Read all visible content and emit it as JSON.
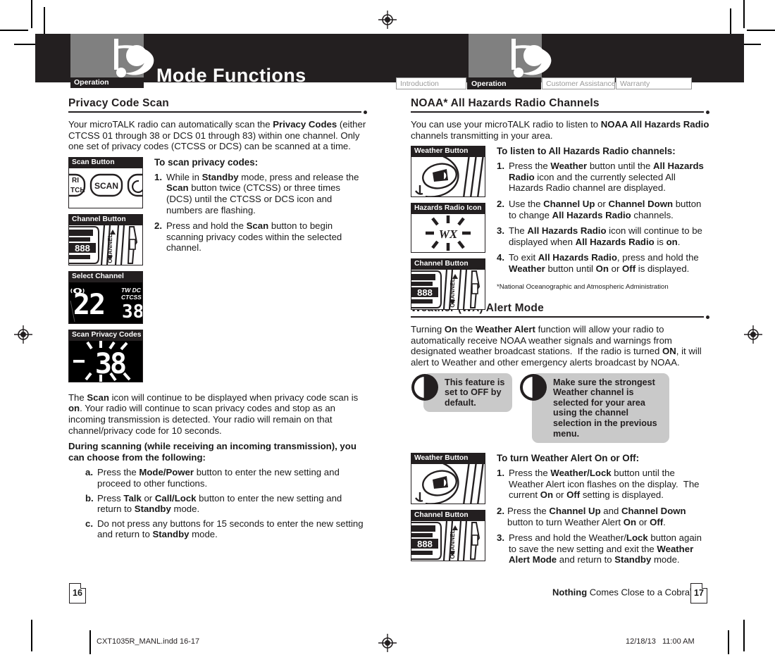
{
  "header": {
    "chapter_title": "Mode Functions",
    "section_tab_left": "Operation",
    "tabs": [
      {
        "label": "Introduction",
        "active": false
      },
      {
        "label": "Operation",
        "active": true
      },
      {
        "label": "Customer Assistance",
        "active": false
      },
      {
        "label": "Warranty",
        "active": false
      }
    ]
  },
  "left_column": {
    "section_title": "Privacy Code Scan",
    "intro": "Your microTALK radio can automatically scan the Privacy Codes (either CTCSS 01 through 38 or DCS 01 through 83) within one channel. Only one set of privacy codes (CTCSS or DCS) can be scanned at a time.",
    "figures": [
      {
        "caption": "Scan Button",
        "art": "scan-button",
        "lcd_text": "SCAN"
      },
      {
        "caption": "Channel Button",
        "art": "channel-button",
        "lcd_text": "888"
      },
      {
        "caption": "Select Channel",
        "art": "lcd-select-channel",
        "lcd_text": "22 38",
        "lcd_labels": "TW DC CTCSS"
      },
      {
        "caption": "Scan Privacy Codes",
        "art": "lcd-scan-privacy",
        "lcd_text": "38"
      }
    ],
    "sub_heading": "To scan privacy codes:",
    "steps": [
      {
        "num": "1.",
        "text": "While in Standby mode, press and release the Scan button twice (CTCSS) or three times (DCS) until the CTCSS or DCS icon and numbers are flashing."
      },
      {
        "num": "2.",
        "text": "Press and hold the Scan button to begin scanning privacy codes within the selected channel."
      }
    ],
    "body_after": "The Scan icon will continue to be displayed when privacy code scan is on. Your radio will continue to scan privacy codes and stop as an incoming transmission is detected. Your radio will remain on that channel/privacy code for 10 seconds.",
    "during_heading": "During scanning (while receiving an incoming transmission), you can choose from the following:",
    "alpha_steps": [
      {
        "num": "a.",
        "text": "Press the Mode/Power button to enter the new setting and proceed to other functions."
      },
      {
        "num": "b.",
        "text": "Press Talk or Call/Lock button to enter the new setting and return to Standby mode."
      },
      {
        "num": "c.",
        "text": "Do not press any buttons for 15 seconds to enter the new setting and return to Standby mode."
      }
    ]
  },
  "right_column": {
    "noaa": {
      "section_title": "NOAA* All Hazards Radio Channels",
      "intro": "You can use your microTALK radio to listen to NOAA All Hazards Radio channels transmitting in your area.",
      "figures": [
        {
          "caption": "Weather Button",
          "art": "weather-button"
        },
        {
          "caption": "Hazards Radio Icon",
          "art": "wx-icon",
          "lcd_text": "WX"
        },
        {
          "caption": "Channel Button",
          "art": "channel-button",
          "lcd_text": "888"
        }
      ],
      "sub_heading": "To listen to All Hazards Radio channels:",
      "steps": [
        {
          "num": "1.",
          "text": "Press the Weather button until the All Hazards Radio icon and the currently selected All Hazards Radio channel are displayed."
        },
        {
          "num": "2.",
          "text": "Use the Channel Up or Channel Down button to change All Hazards Radio channels."
        },
        {
          "num": "3.",
          "text": "The All Hazards Radio icon will continue to be displayed when All Hazards Radio is on."
        },
        {
          "num": "4.",
          "text": "To exit All Hazards Radio, press and hold the Weather button until On or Off is displayed."
        }
      ],
      "footnote": "*National Oceanographic and Atmospheric Administration"
    },
    "wx_alert": {
      "section_title": "Weather (WX) Alert Mode",
      "intro": "Turning On the Weather Alert function will allow your radio to automatically receive NOAA weather signals and warnings from designated weather broadcast stations.  If the radio is turned ON, it will alert to Weather and other emergency alerts broadcast by NOAA.",
      "notes": [
        {
          "icon": "note-icon",
          "text": "This feature is set to OFF by default."
        },
        {
          "icon": "note-icon",
          "text": "Make sure the strongest Weather channel is selected for your area using the channel selection in the previous menu."
        }
      ],
      "figures": [
        {
          "caption": "Weather Button",
          "art": "weather-button"
        },
        {
          "caption": "Channel Button",
          "art": "channel-button",
          "lcd_text": "888"
        }
      ],
      "sub_heading": "To turn Weather Alert On or Off:",
      "steps": [
        {
          "num": "1.",
          "text": "Press the Weather/Lock button until the Weather Alert icon flashes on the display.  The current On or Off setting is displayed."
        },
        {
          "num": "2.",
          "text": "Press the Channel Up and Channel Down button to turn Weather Alert On or Off."
        },
        {
          "num": "3.",
          "text": "Press and hold the Weather/Lock button again to save the new setting and exit the Weather Alert Mode and return to Standby mode."
        }
      ]
    }
  },
  "footer": {
    "page_left": "16",
    "page_right": "17",
    "tagline_bold": "Nothing",
    "tagline_rest": " Comes Close to a Cobra",
    "tagline_mark": "®",
    "print_file": "CXT1035R_MANL.indd   16-17",
    "print_date": "12/18/13",
    "print_time": "11:00 AM"
  },
  "colors": {
    "ink": "#231f20",
    "gray_panel": "#808080",
    "note_gray": "#c9c9c9",
    "tab_inactive": "#9a9a9a"
  }
}
